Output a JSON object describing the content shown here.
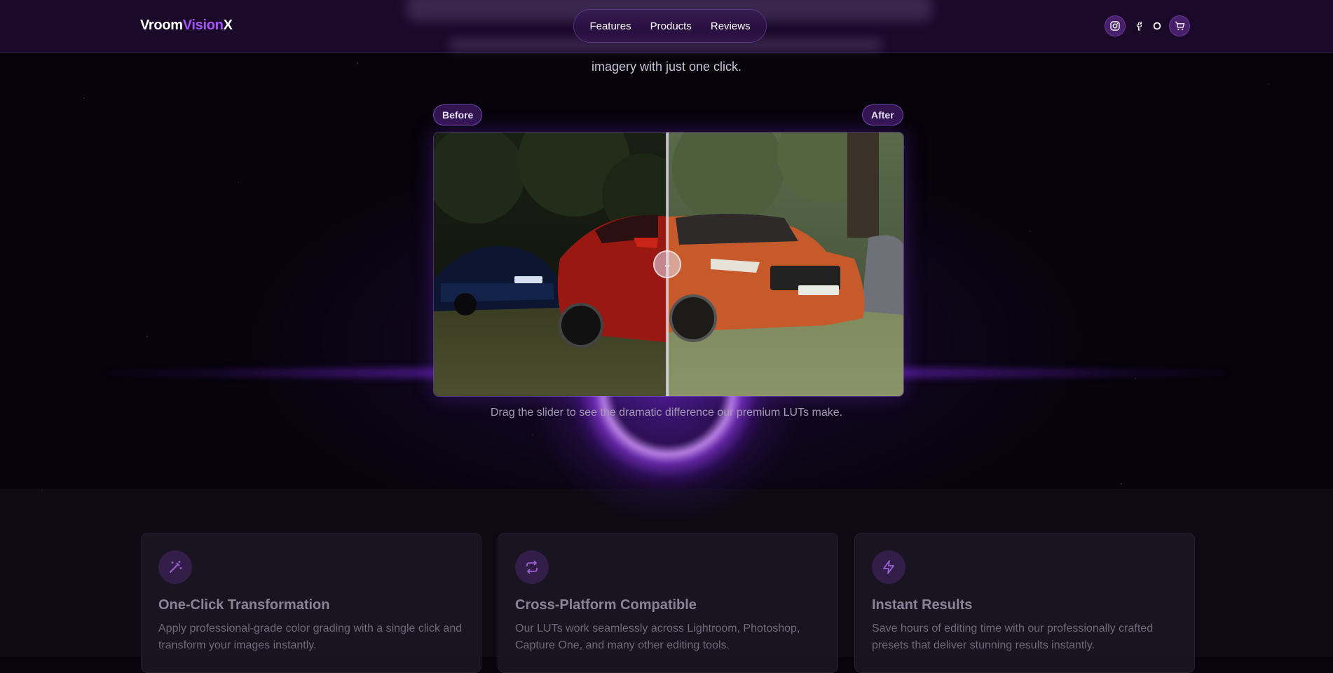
{
  "brand": {
    "part1": "Vroom",
    "part2": "Vision",
    "part3": "X"
  },
  "nav": [
    {
      "label": "Features"
    },
    {
      "label": "Products"
    },
    {
      "label": "Reviews"
    }
  ],
  "header_icons": [
    "instagram-icon",
    "facebook-icon",
    "threads-icon",
    "cart-icon"
  ],
  "hero": {
    "subline": "imagery with just one click.",
    "before_label": "Before",
    "after_label": "After",
    "caption": "Drag the slider to see the dramatic difference our premium LUTs make.",
    "slider_position": 0.5
  },
  "features": [
    {
      "icon": "magic-wand-icon",
      "title": "One-Click Transformation",
      "text": "Apply professional-grade color grading with a single click and transform your images instantly."
    },
    {
      "icon": "repeat-icon",
      "title": "Cross-Platform Compatible",
      "text": "Our LUTs work seamlessly across Lightroom, Photoshop, Capture One, and many other editing tools."
    },
    {
      "icon": "lightning-icon",
      "title": "Instant Results",
      "text": "Save hours of editing time with our professionally crafted presets that deliver stunning results instantly."
    }
  ],
  "colors": {
    "accent": "#a855f7",
    "background": "#07040d",
    "header": "#1c0a2d"
  }
}
